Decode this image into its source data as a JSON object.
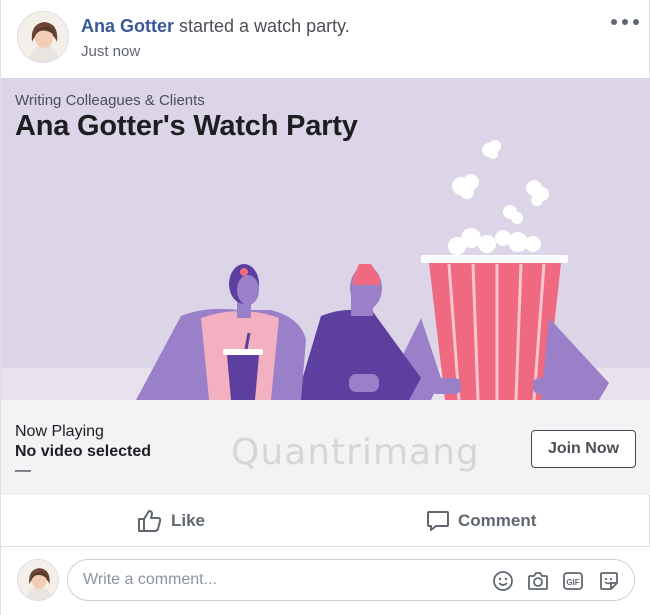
{
  "post": {
    "author": "Ana Gotter",
    "action_text": " started a watch party.",
    "timestamp": "Just now"
  },
  "banner": {
    "subtitle": "Writing Colleagues & Clients",
    "title": "Ana Gotter's Watch Party"
  },
  "now_playing": {
    "label": "Now Playing",
    "value": "No video selected",
    "dash": "—",
    "join_label": "Join Now"
  },
  "watermark": "Quantrimang",
  "actions": {
    "like_label": "Like",
    "comment_label": "Comment"
  },
  "comment_box": {
    "placeholder": "Write a comment..."
  },
  "icons": {
    "more": "more-horizontal-icon",
    "like": "thumbs-up-icon",
    "comment": "speech-bubble-icon",
    "emoji": "smiley-icon",
    "camera": "camera-icon",
    "gif": "gif-icon",
    "sticker": "sticker-icon"
  },
  "colors": {
    "author_link": "#385898",
    "banner_bg": "#dcd4e7",
    "popcorn_red": "#ef6a80",
    "purple": "#9a7fc9",
    "dark_purple": "#5c3f9e"
  }
}
